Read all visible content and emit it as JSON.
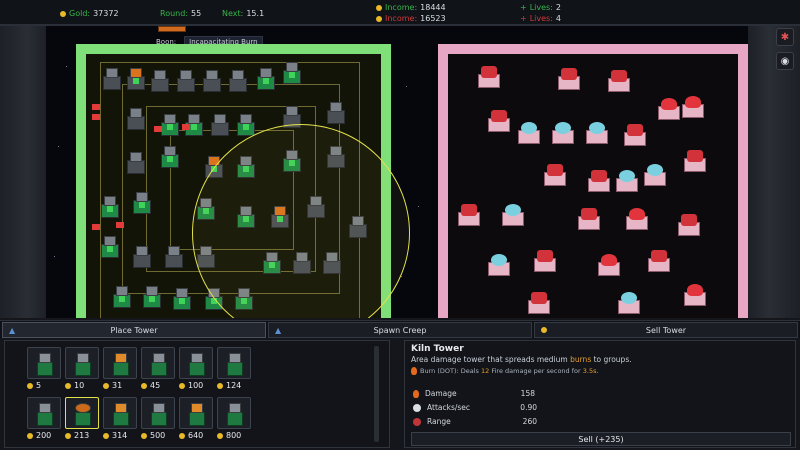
{
  "topbar": {
    "gold_label": "Gold:",
    "gold_value": "37372",
    "round_label": "Round:",
    "round_value": "55",
    "next_label": "Next:",
    "next_value": "15.1",
    "income_green_label": "Income:",
    "income_green_value": "18444",
    "income_red_label": "Income:",
    "income_red_value": "16523",
    "lives_green_label": "Lives:",
    "lives_green_value": "2",
    "lives_red_label": "Lives:",
    "lives_red_value": "4"
  },
  "boon": {
    "label": "Boon:",
    "value": "Incapacitating Burn"
  },
  "tabs": [
    {
      "label": "Place Tower",
      "icon": "tower-icon"
    },
    {
      "label": "Spawn Creep",
      "icon": "creep-icon"
    },
    {
      "label": "Sell Tower",
      "icon": "coin-icon"
    }
  ],
  "shop": {
    "items": [
      {
        "price": "5",
        "icon": "stone-tower-icon"
      },
      {
        "price": "10",
        "icon": "cannon-tower-icon"
      },
      {
        "price": "31",
        "icon": "spire-tower-icon"
      },
      {
        "price": "45",
        "icon": "twin-spire-tower-icon"
      },
      {
        "price": "100",
        "icon": "castle-tower-icon"
      },
      {
        "price": "124",
        "icon": "arcane-tower-icon"
      },
      {
        "price": "200",
        "icon": "stone-spire-tower-icon"
      },
      {
        "price": "213",
        "icon": "kiln-tower-icon"
      },
      {
        "price": "314",
        "icon": "flame-tower-icon"
      },
      {
        "price": "500",
        "icon": "guard-tower-icon"
      },
      {
        "price": "640",
        "icon": "inferno-tower-icon"
      },
      {
        "price": "800",
        "icon": "citadel-tower-icon"
      }
    ]
  },
  "info": {
    "title": "Kiln Tower",
    "desc_pre": "Area damage tower that spreads medium ",
    "desc_hl": "burns",
    "desc_post": " to groups.",
    "burn_pre": "Burn (DOT): Deals ",
    "burn_val": "12",
    "burn_mid": " Fire damage per second for ",
    "burn_dur": "3.5s",
    "burn_post": ".",
    "stats": [
      {
        "label": "Damage",
        "value": "158",
        "icon": "damage-icon",
        "color": "#e36a1d"
      },
      {
        "label": "Attacks/sec",
        "value": "0.90",
        "icon": "speed-icon",
        "color": "#d9dee5"
      },
      {
        "label": "Range",
        "value": "260",
        "icon": "range-icon",
        "color": "#c0353a"
      }
    ],
    "sell_label": "Sell (+235)"
  },
  "colors": {
    "gold": "#e8b928",
    "green_team": "#39b54a",
    "red_team": "#d03a3a",
    "range_ring": "#e2e14a"
  }
}
